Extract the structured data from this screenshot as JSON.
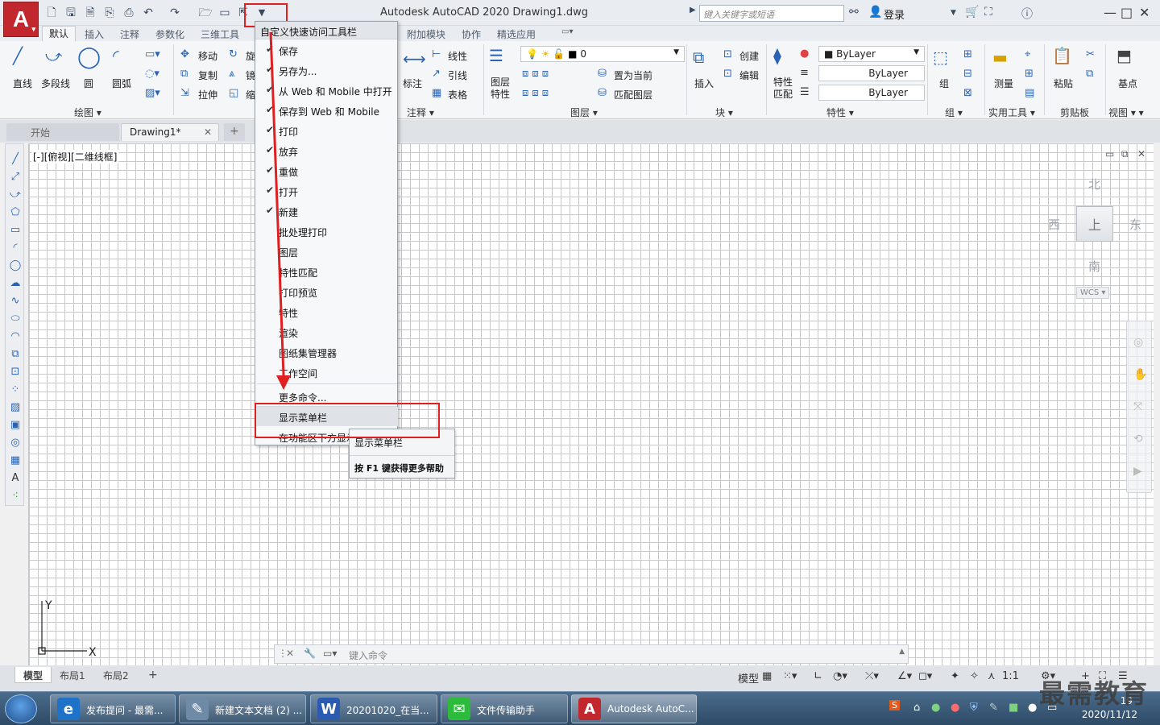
{
  "title_bar": {
    "app_logo": "A",
    "title": "Autodesk AutoCAD 2020    Drawing1.dwg",
    "search_placeholder": "键入关键字或短语",
    "login": "登录"
  },
  "ribbon_tabs": [
    "默认",
    "插入",
    "注释",
    "参数化",
    "三维工具",
    "附加模块",
    "协作",
    "精选应用"
  ],
  "ribbon": {
    "draw": {
      "line": "直线",
      "polyline": "多段线",
      "circle": "圆",
      "arc": "圆弧",
      "title": "绘图"
    },
    "modify": {
      "move": "移动",
      "rotate": "旋",
      "copy": "复制",
      "mirror": "镜",
      "stretch": "拉伸",
      "scale": "缩"
    },
    "annotation": {
      "dimension": "标注",
      "linetype": "线性",
      "leader": "引线",
      "table": "表格",
      "title": "注释"
    },
    "layers": {
      "properties": "图层\n特性",
      "current_layer": "0",
      "set_current": "置为当前",
      "match_layer": "匹配图层",
      "title": "图层"
    },
    "block": {
      "insert": "插入",
      "create": "创建",
      "edit": "编辑",
      "title": "块"
    },
    "properties": {
      "match": "特性\n匹配",
      "color": "ByLayer",
      "lineweight": "ByLayer",
      "linetype": "ByLayer",
      "title": "特性"
    },
    "groups": {
      "group": "组",
      "title": "组"
    },
    "utilities": {
      "measure": "测量",
      "title": "实用工具"
    },
    "clipboard": {
      "paste": "粘贴",
      "title": "剪贴板"
    },
    "view": {
      "base": "基点",
      "title": "视图"
    }
  },
  "file_tabs": [
    {
      "label": "开始",
      "active": false
    },
    {
      "label": "Drawing1*",
      "active": true
    }
  ],
  "viewport": {
    "label": "[-][俯视][二维线框]",
    "viewcube": {
      "north": "北",
      "south": "南",
      "east": "东",
      "west": "西",
      "top": "上",
      "wcs": "WCS"
    },
    "ucs_y": "Y",
    "ucs_x": "X"
  },
  "command_line": {
    "placeholder": "键入命令"
  },
  "layout_tabs": [
    "模型",
    "布局1",
    "布局2"
  ],
  "status_bar": {
    "model": "模型",
    "scale": "1:1"
  },
  "qat_menu": {
    "header": "自定义快速访问工具栏",
    "items": [
      {
        "label": "保存",
        "checked": true
      },
      {
        "label": "另存为...",
        "checked": true
      },
      {
        "label": "从 Web 和 Mobile 中打开",
        "checked": true
      },
      {
        "label": "保存到 Web 和 Mobile",
        "checked": true
      },
      {
        "label": "打印",
        "checked": true
      },
      {
        "label": "放弃",
        "checked": true
      },
      {
        "label": "重做",
        "checked": true
      },
      {
        "label": "打开",
        "checked": true
      },
      {
        "label": "新建",
        "checked": true
      },
      {
        "label": "批处理打印",
        "checked": false
      },
      {
        "label": "图层",
        "checked": false
      },
      {
        "label": "特性匹配",
        "checked": false
      },
      {
        "label": "打印预览",
        "checked": false
      },
      {
        "label": "特性",
        "checked": false
      },
      {
        "label": "渲染",
        "checked": false
      },
      {
        "label": "图纸集管理器",
        "checked": false
      },
      {
        "label": "工作空间",
        "checked": false
      }
    ],
    "more": "更多命令...",
    "show_menubar": "显示菜单栏",
    "below_ribbon": "在功能区下方显示"
  },
  "tooltip": {
    "title": "显示菜单栏",
    "help": "按 F1 键获得更多帮助"
  },
  "taskbar": {
    "items": [
      {
        "label": "发布提问 - 最需...",
        "icon": "ie-icon",
        "color": "#1e73c8"
      },
      {
        "label": "新建文本文档 (2) ...",
        "icon": "notepad-icon",
        "color": "#6f8aa6"
      },
      {
        "label": "20201020_在当...",
        "icon": "word-icon",
        "color": "#2b5bb0"
      },
      {
        "label": "文件传输助手",
        "icon": "wechat-icon",
        "color": "#2dbb3c"
      },
      {
        "label": "Autodesk AutoC...",
        "icon": "autocad-icon",
        "color": "#c1272d"
      }
    ],
    "date": "2020/11/12",
    "time": "19"
  },
  "watermark": "最需教育",
  "colors": {
    "highlight_red": "#e02020",
    "accent_blue": "#2a63b4"
  }
}
